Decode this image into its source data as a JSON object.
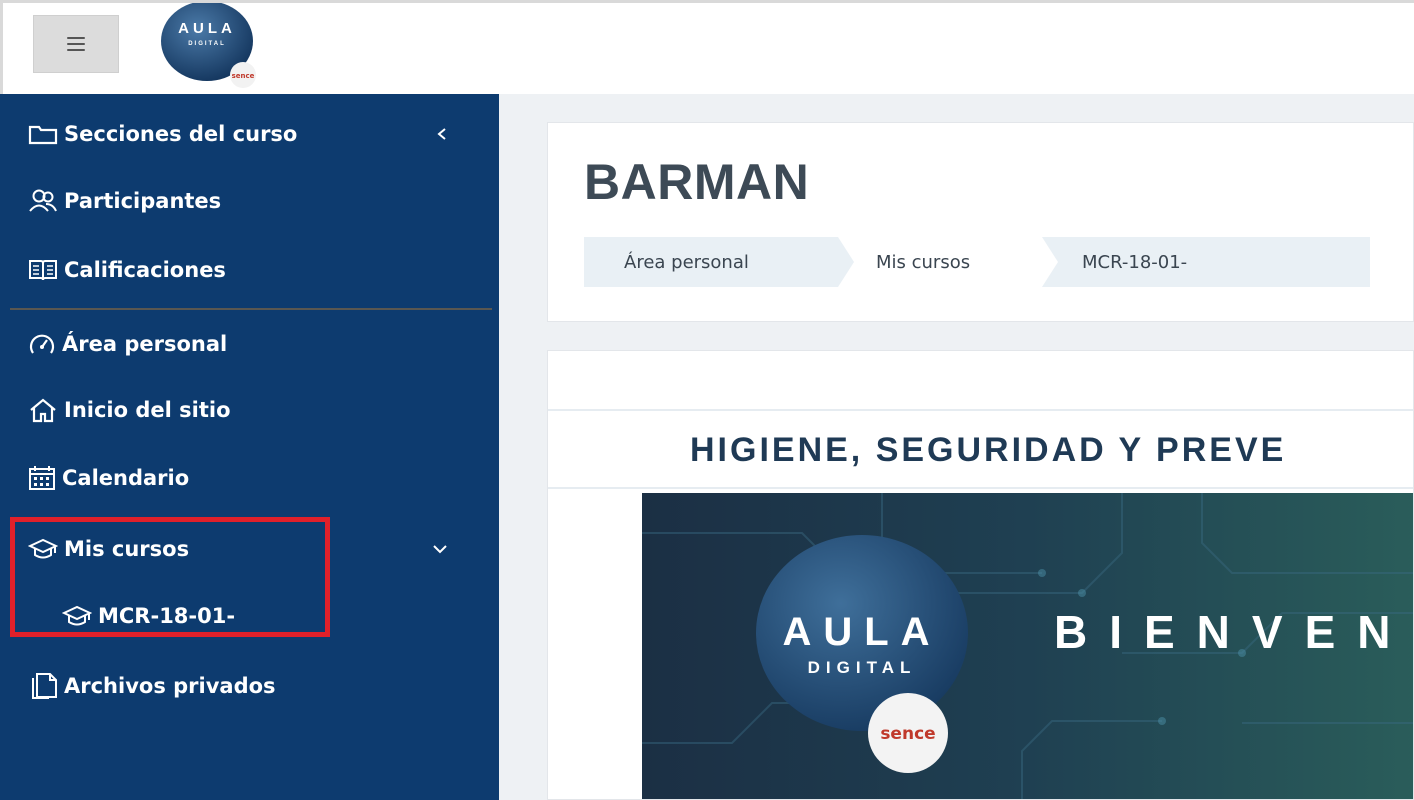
{
  "header": {
    "logo": {
      "main": "AULA",
      "sub": "DIGITAL",
      "badge": "sence"
    }
  },
  "sidebar": {
    "items": [
      {
        "label": "Secciones del curso",
        "icon": "folder-icon"
      },
      {
        "label": "Participantes",
        "icon": "users-icon"
      },
      {
        "label": "Calificaciones",
        "icon": "grades-icon"
      },
      {
        "label": "Área personal",
        "icon": "dashboard-icon"
      },
      {
        "label": "Inicio del sitio",
        "icon": "home-icon"
      },
      {
        "label": "Calendario",
        "icon": "calendar-icon"
      },
      {
        "label": "Mis cursos",
        "icon": "graduation-cap-icon"
      },
      {
        "label": "MCR-18-01-",
        "icon": "graduation-cap-icon"
      },
      {
        "label": "Archivos privados",
        "icon": "files-icon"
      }
    ]
  },
  "main": {
    "title": "BARMAN",
    "breadcrumb": [
      "Área personal",
      "Mis cursos",
      "MCR-18-01-"
    ],
    "course_heading": "HIGIENE, SEGURIDAD Y PREVE",
    "banner": {
      "logo_main": "AULA",
      "logo_sub": "DIGITAL",
      "badge": "sence",
      "welcome": "BIENVEN"
    }
  },
  "colors": {
    "sidebar_bg": "#0d3b6f",
    "highlight_border": "#e0202a",
    "title": "#3d4a56",
    "heading": "#1f3a55"
  }
}
